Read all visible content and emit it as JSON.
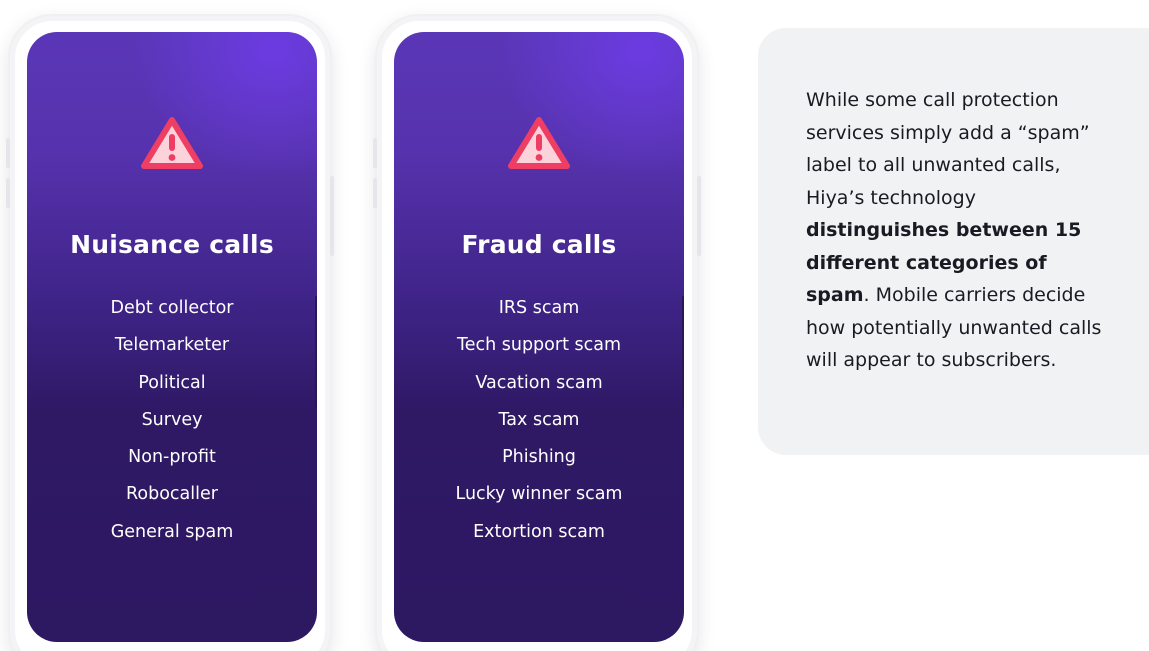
{
  "phones": [
    {
      "title": "Nuisance calls",
      "icon": "warning-icon",
      "items": [
        "Debt collector",
        "Telemarketer",
        "Political",
        "Survey",
        "Non-profit",
        "Robocaller",
        "General spam"
      ]
    },
    {
      "title": "Fraud calls",
      "icon": "warning-icon",
      "items": [
        "IRS scam",
        "Tech support scam",
        "Vacation scam",
        "Tax scam",
        "Phishing",
        "Lucky winner scam",
        "Extortion scam"
      ]
    }
  ],
  "info": {
    "text_before": "While some call protection services simply add a “spam” label to all unwanted calls, Hiya’s technology ",
    "text_bold": "distinguishes between 15 different categories of spam",
    "text_after": ". Mobile carriers decide how potentially unwanted calls will appear to subscribers."
  },
  "colors": {
    "warning_fill": "#fcd3da",
    "warning_stroke": "#ef3e63",
    "screen_top": "#5a37b7",
    "screen_bottom": "#2d1862",
    "card_bg": "#f1f2f4"
  }
}
